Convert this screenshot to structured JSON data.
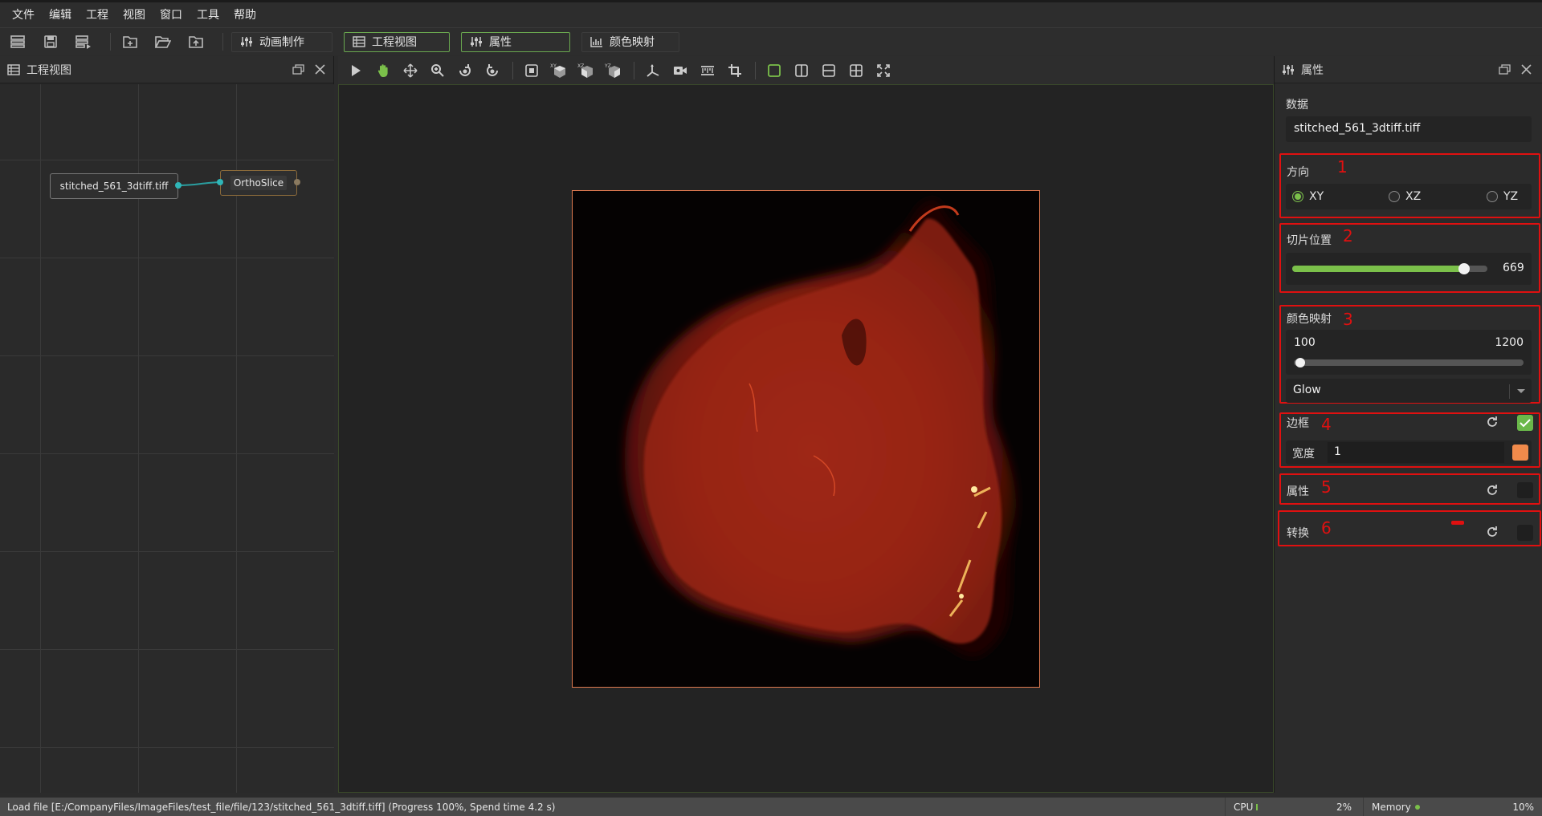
{
  "menu": [
    "文件",
    "编辑",
    "工程",
    "视图",
    "窗口",
    "工具",
    "帮助"
  ],
  "toolbar": {
    "tabs": [
      {
        "label": "动画制作",
        "icon": "sliders-icon"
      },
      {
        "label": "工程视图",
        "icon": "list-icon"
      },
      {
        "label": "属性",
        "icon": "sliders-icon"
      },
      {
        "label": "颜色映射",
        "icon": "chart-icon"
      }
    ]
  },
  "project_view": {
    "title": "工程视图",
    "nodes": {
      "data": "stitched_561_3dtiff.tiff",
      "module": "OrthoSlice"
    }
  },
  "properties": {
    "title": "属性",
    "data_label": "数据",
    "data_value": "stitched_561_3dtiff.tiff",
    "orientation": {
      "label": "方向",
      "options": [
        "XY",
        "XZ",
        "YZ"
      ],
      "selected": "XY"
    },
    "slice": {
      "label": "切片位置",
      "value": "669",
      "fraction": 0.88
    },
    "colormap": {
      "label": "颜色映射",
      "min": "100",
      "max": "1200",
      "preset": "Glow"
    },
    "border": {
      "label": "边框",
      "width_label": "宽度",
      "width_value": "1",
      "checked": true,
      "color": "#f08a4b"
    },
    "attribute": {
      "label": "属性",
      "checked": false
    },
    "transform": {
      "label": "转换",
      "checked": false
    },
    "annotations": [
      "1",
      "2",
      "3",
      "4",
      "5",
      "6"
    ]
  },
  "status": {
    "message": "Load file [E:/CompanyFiles/ImageFiles/test_file/file/123/stitched_561_3dtiff.tiff] (Progress 100%, Spend time 4.2 s)",
    "cpu_label": "CPU",
    "cpu_value": "2%",
    "memory_label": "Memory",
    "memory_value": "10%"
  },
  "colors": {
    "accent": "#7bc04a",
    "annotation": "#e01010",
    "border": "#e07a50"
  }
}
